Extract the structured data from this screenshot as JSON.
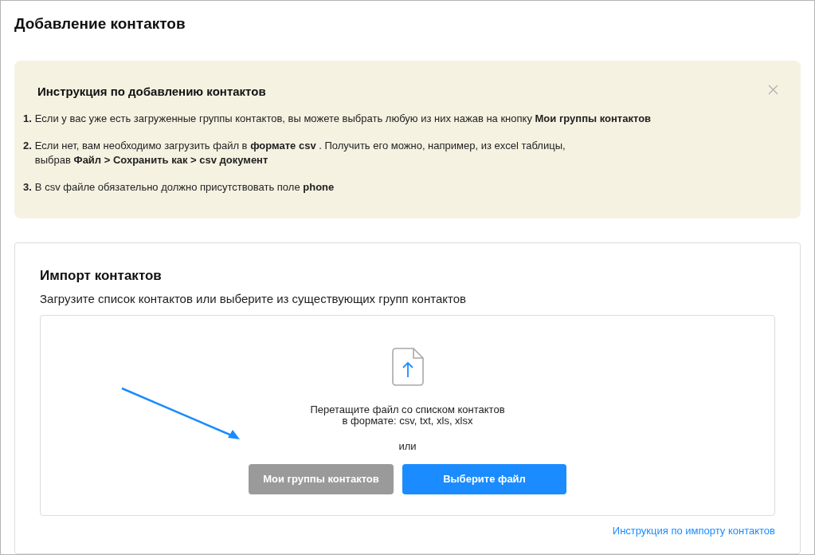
{
  "page": {
    "title": "Добавление контактов"
  },
  "instructions": {
    "title": "Инструкция по добавлению контактов",
    "closable": true,
    "steps": [
      {
        "number": "1.",
        "lines": [
          "Если у вас уже есть загруженные группы контактов, вы можете выбрать любую из них нажав на кнопку **Мои группы контактов**"
        ]
      },
      {
        "number": "2.",
        "lines": [
          "Если нет, вам необходимо загрузить файл в **формате csv** . Получить его можно, например, из excel таблицы,",
          "выбрав **Файл > Сохранить как > csv документ**"
        ]
      },
      {
        "number": "3.",
        "lines": [
          "В csv файле обязательно должно присутствовать поле **phone**"
        ]
      }
    ]
  },
  "import": {
    "title": "Импорт контактов",
    "subtitle": "Загрузите список контактов или выберите из существующих групп контактов",
    "dropzone": {
      "hint_lines": [
        "Перетащите файл со списком контактов",
        "в формате: csv, txt, xls, xlsx"
      ],
      "separator": "или",
      "buttons": [
        {
          "label": "Мои группы контактов",
          "kind": "secondary"
        },
        {
          "label": "Выберите файл",
          "kind": "primary"
        }
      ]
    },
    "help_link": "Инструкция по импорту контактов"
  }
}
